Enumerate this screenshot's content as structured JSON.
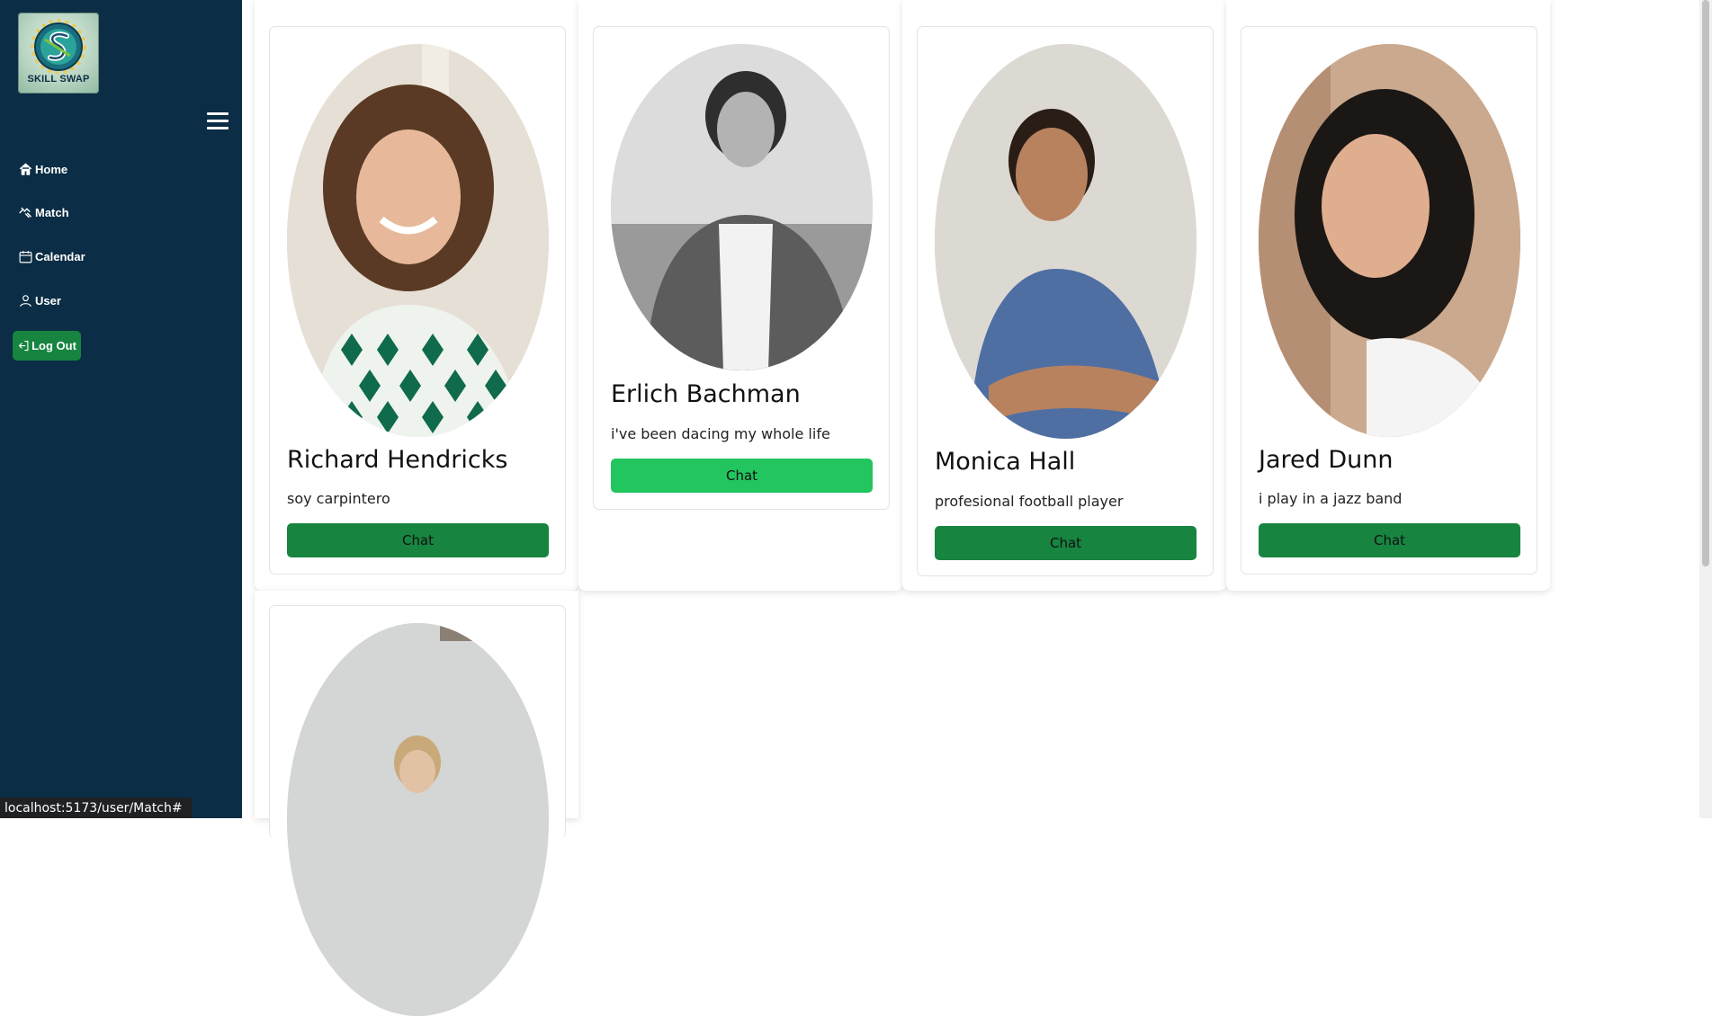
{
  "app": {
    "logo_text": "SKILL SWAP"
  },
  "sidebar": {
    "items": [
      {
        "label": "Home",
        "icon": "home-icon"
      },
      {
        "label": "Match",
        "icon": "match-icon"
      },
      {
        "label": "Calendar",
        "icon": "calendar-icon"
      },
      {
        "label": "User",
        "icon": "user-icon"
      }
    ],
    "logout_label": "Log Out"
  },
  "cards": [
    {
      "name": "Richard Hendricks",
      "description": "soy carpintero",
      "button": "Chat"
    },
    {
      "name": "Erlich Bachman",
      "description": "i've been dacing my whole life",
      "button": "Chat"
    },
    {
      "name": "Monica Hall",
      "description": "profesional football player",
      "button": "Chat"
    },
    {
      "name": "Jared Dunn",
      "description": "i play in a jazz band",
      "button": "Chat"
    },
    {
      "name": "",
      "description": "",
      "button": ""
    }
  ],
  "colors": {
    "sidebar_bg": "#0b2d45",
    "button_primary": "#178440",
    "button_hover": "#22c55e"
  },
  "status_bar": {
    "url": "localhost:5173/user/Match#"
  }
}
